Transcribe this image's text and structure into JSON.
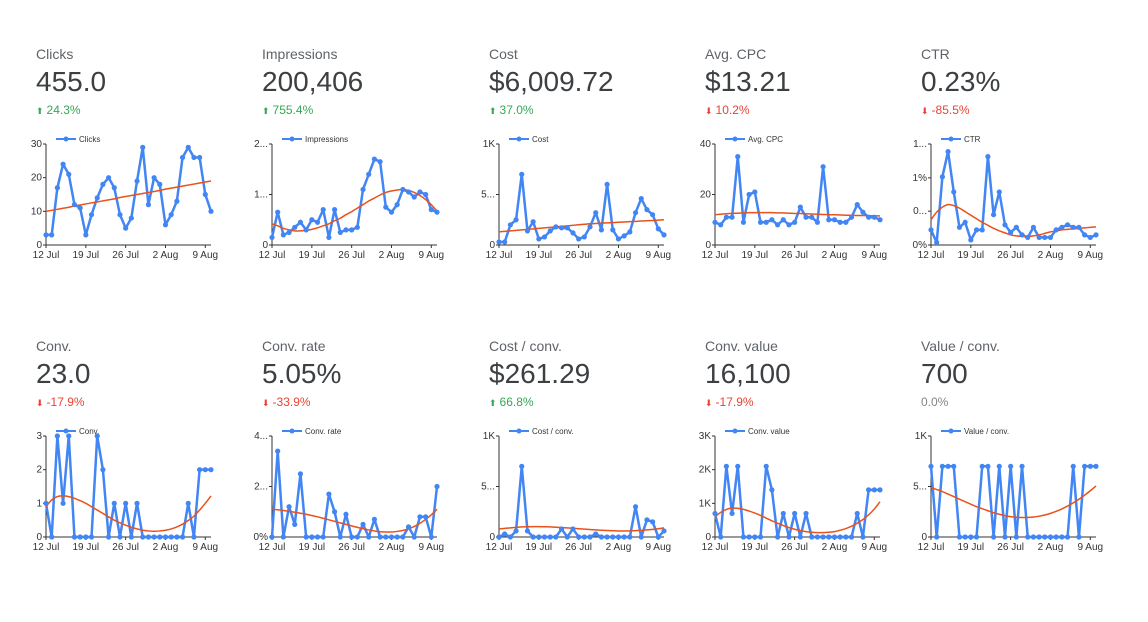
{
  "colors": {
    "series": "#4285f4",
    "trend": "#e8521c",
    "up": "#34a853",
    "down": "#ea4335",
    "flat": "#80868b",
    "axis": "#333333"
  },
  "icons": {
    "up": "arrow-up-icon",
    "down": "arrow-down-icon"
  },
  "chart_data": [
    {
      "type": "line",
      "label": "Clicks",
      "value": "455.0",
      "change": "24.3%",
      "direction": "up",
      "legend": "Clicks",
      "ylim": [
        0,
        30
      ],
      "yticks": [
        {
          "v": 0,
          "t": "0"
        },
        {
          "v": 10,
          "t": "10"
        },
        {
          "v": 20,
          "t": "20"
        },
        {
          "v": 30,
          "t": "30"
        }
      ],
      "x": [
        "12 Jul",
        "19 Jul",
        "26 Jul",
        "2 Aug",
        "9 Aug"
      ],
      "values": [
        3,
        3,
        17,
        24,
        21,
        12,
        11,
        3,
        9,
        14,
        18,
        20,
        17,
        9,
        5,
        8,
        19,
        29,
        12,
        20,
        18,
        6,
        9,
        13,
        26,
        29,
        26,
        26,
        15,
        10
      ],
      "trend": [
        10,
        10.3,
        10.6,
        10.9,
        11.2,
        11.6,
        11.9,
        12.2,
        12.5,
        12.8,
        13.1,
        13.4,
        13.7,
        14.1,
        14.4,
        14.7,
        15,
        15.3,
        15.6,
        15.9,
        16.2,
        16.6,
        16.9,
        17.2,
        17.5,
        17.8,
        18.1,
        18.4,
        18.7,
        19
      ]
    },
    {
      "type": "line",
      "label": "Impressions",
      "value": "200,406",
      "change": "755.4%",
      "direction": "up",
      "legend": "Impressions",
      "ylim": [
        0,
        2
      ],
      "yticks": [
        {
          "v": 0,
          "t": "0"
        },
        {
          "v": 1,
          "t": "1..."
        },
        {
          "v": 2,
          "t": "2..."
        }
      ],
      "x": [
        "12 Jul",
        "19 Jul",
        "26 Jul",
        "2 Aug",
        "9 Aug"
      ],
      "values": [
        0.15,
        0.65,
        0.2,
        0.25,
        0.35,
        0.45,
        0.3,
        0.5,
        0.45,
        0.7,
        0.15,
        0.7,
        0.25,
        0.3,
        0.3,
        0.35,
        1.1,
        1.4,
        1.7,
        1.65,
        0.75,
        0.65,
        0.8,
        1.1,
        1.05,
        0.95,
        1.05,
        1,
        0.7,
        0.65
      ],
      "trend": [
        0.42,
        0.38,
        0.33,
        0.3,
        0.28,
        0.28,
        0.29,
        0.31,
        0.34,
        0.38,
        0.42,
        0.48,
        0.53,
        0.6,
        0.66,
        0.73,
        0.8,
        0.87,
        0.93,
        0.99,
        1.04,
        1.07,
        1.09,
        1.1,
        1.08,
        1.04,
        0.98,
        0.9,
        0.8,
        0.67
      ]
    },
    {
      "type": "line",
      "label": "Cost",
      "value": "$6,009.72",
      "change": "37.0%",
      "direction": "up",
      "legend": "Cost",
      "ylim": [
        0,
        1000
      ],
      "yticks": [
        {
          "v": 0,
          "t": "0"
        },
        {
          "v": 500,
          "t": "5..."
        },
        {
          "v": 1000,
          "t": "1K"
        }
      ],
      "x": [
        "12 Jul",
        "19 Jul",
        "26 Jul",
        "2 Aug",
        "9 Aug"
      ],
      "values": [
        30,
        30,
        200,
        250,
        700,
        140,
        230,
        60,
        80,
        140,
        180,
        170,
        170,
        120,
        60,
        80,
        180,
        320,
        150,
        600,
        150,
        60,
        90,
        130,
        320,
        460,
        350,
        300,
        160,
        100
      ],
      "trend": [
        130,
        135,
        140,
        145,
        150,
        155,
        160,
        165,
        170,
        175,
        180,
        185,
        190,
        195,
        200,
        205,
        210,
        213,
        216,
        219,
        222,
        225,
        228,
        231,
        234,
        237,
        240,
        243,
        246,
        250
      ]
    },
    {
      "type": "line",
      "label": "Avg. CPC",
      "value": "$13.21",
      "change": "10.2%",
      "direction": "down",
      "legend": "Avg. CPC",
      "ylim": [
        0,
        40
      ],
      "yticks": [
        {
          "v": 0,
          "t": "0"
        },
        {
          "v": 20,
          "t": "20"
        },
        {
          "v": 40,
          "t": "40"
        }
      ],
      "x": [
        "12 Jul",
        "19 Jul",
        "26 Jul",
        "2 Aug",
        "9 Aug"
      ],
      "values": [
        9,
        8,
        11,
        11,
        35,
        9,
        20,
        21,
        9,
        9,
        10,
        8,
        10,
        8,
        9,
        15,
        11,
        11,
        9,
        31,
        10,
        10,
        9,
        9,
        11,
        16,
        13,
        11,
        11,
        10
      ],
      "trend": [
        12,
        12.2,
        12.4,
        12.5,
        12.6,
        12.7,
        12.8,
        12.8,
        12.8,
        12.8,
        12.8,
        12.7,
        12.7,
        12.6,
        12.5,
        12.5,
        12.4,
        12.3,
        12.2,
        12.1,
        12,
        12,
        11.9,
        11.8,
        11.8,
        11.7,
        11.7,
        11.6,
        11.6,
        11.5
      ]
    },
    {
      "type": "line",
      "label": "CTR",
      "value": "0.23%",
      "change": "-85.5%",
      "direction": "down",
      "legend": "CTR",
      "ylim": [
        0,
        2
      ],
      "yticks": [
        {
          "v": 0,
          "t": "0%"
        },
        {
          "v": 0.67,
          "t": "0..."
        },
        {
          "v": 1.33,
          "t": "1%"
        },
        {
          "v": 2,
          "t": "1..."
        }
      ],
      "x": [
        "12 Jul",
        "19 Jul",
        "26 Jul",
        "2 Aug",
        "9 Aug"
      ],
      "values": [
        0.3,
        0.05,
        1.35,
        1.85,
        1.05,
        0.35,
        0.45,
        0.1,
        0.3,
        0.3,
        1.75,
        0.6,
        1.05,
        0.4,
        0.25,
        0.35,
        0.2,
        0.15,
        0.35,
        0.15,
        0.15,
        0.15,
        0.3,
        0.35,
        0.4,
        0.35,
        0.35,
        0.2,
        0.15,
        0.2
      ],
      "trend": [
        0.5,
        0.65,
        0.75,
        0.8,
        0.78,
        0.73,
        0.66,
        0.59,
        0.52,
        0.45,
        0.39,
        0.33,
        0.28,
        0.24,
        0.2,
        0.18,
        0.17,
        0.17,
        0.18,
        0.2,
        0.23,
        0.26,
        0.28,
        0.3,
        0.31,
        0.32,
        0.33,
        0.34,
        0.35,
        0.36
      ]
    },
    {
      "type": "line",
      "label": "Conv.",
      "value": "23.0",
      "change": "-17.9%",
      "direction": "down",
      "legend": "Conv.",
      "ylim": [
        0,
        3
      ],
      "yticks": [
        {
          "v": 0,
          "t": "0"
        },
        {
          "v": 1,
          "t": "1"
        },
        {
          "v": 2,
          "t": "2"
        },
        {
          "v": 3,
          "t": "3"
        }
      ],
      "x": [
        "12 Jul",
        "19 Jul",
        "26 Jul",
        "2 Aug",
        "9 Aug"
      ],
      "values": [
        1,
        0,
        3,
        1,
        3,
        0,
        0,
        0,
        0,
        3,
        2,
        0,
        1,
        0,
        1,
        0,
        1,
        0,
        0,
        0,
        0,
        0,
        0,
        0,
        0,
        1,
        0,
        2,
        2,
        2
      ],
      "trend": [
        0.9,
        1.1,
        1.2,
        1.22,
        1.2,
        1.15,
        1.08,
        1,
        0.9,
        0.8,
        0.7,
        0.6,
        0.5,
        0.42,
        0.35,
        0.29,
        0.24,
        0.2,
        0.18,
        0.17,
        0.18,
        0.2,
        0.24,
        0.3,
        0.38,
        0.49,
        0.62,
        0.8,
        1,
        1.22
      ]
    },
    {
      "type": "line",
      "label": "Conv. rate",
      "value": "5.05%",
      "change": "-33.9%",
      "direction": "down",
      "legend": "Conv. rate",
      "ylim": [
        0,
        4
      ],
      "yticks": [
        {
          "v": 0,
          "t": "0%"
        },
        {
          "v": 2,
          "t": "2..."
        },
        {
          "v": 4,
          "t": "4..."
        }
      ],
      "x": [
        "12 Jul",
        "19 Jul",
        "26 Jul",
        "2 Aug",
        "9 Aug"
      ],
      "values": [
        0,
        3.4,
        0,
        1.2,
        0.5,
        2.5,
        0,
        0,
        0,
        0,
        1.7,
        1,
        0,
        0.9,
        0,
        0,
        0.5,
        0,
        0.7,
        0,
        0,
        0,
        0,
        0,
        0.4,
        0,
        0.8,
        0.8,
        0,
        2
      ],
      "trend": [
        1.1,
        1.08,
        1.05,
        1.02,
        0.98,
        0.94,
        0.9,
        0.85,
        0.8,
        0.74,
        0.68,
        0.62,
        0.56,
        0.5,
        0.44,
        0.38,
        0.33,
        0.28,
        0.24,
        0.21,
        0.2,
        0.2,
        0.22,
        0.26,
        0.32,
        0.42,
        0.54,
        0.7,
        0.88,
        1.1
      ]
    },
    {
      "type": "line",
      "label": "Cost / conv.",
      "value": "$261.29",
      "change": "66.8%",
      "direction": "up",
      "legend": "Cost / conv.",
      "ylim": [
        0,
        1000
      ],
      "yticks": [
        {
          "v": 0,
          "t": "0"
        },
        {
          "v": 500,
          "t": "5..."
        },
        {
          "v": 1000,
          "t": "1K"
        }
      ],
      "x": [
        "12 Jul",
        "19 Jul",
        "26 Jul",
        "2 Aug",
        "9 Aug"
      ],
      "values": [
        0,
        30,
        0,
        60,
        700,
        60,
        0,
        0,
        0,
        0,
        0,
        80,
        0,
        80,
        0,
        0,
        0,
        30,
        0,
        0,
        0,
        0,
        0,
        0,
        300,
        0,
        170,
        150,
        0,
        60
      ],
      "trend": [
        80,
        85,
        90,
        95,
        100,
        102,
        103,
        103,
        102,
        100,
        97,
        94,
        90,
        86,
        82,
        78,
        74,
        70,
        67,
        64,
        62,
        60,
        60,
        61,
        63,
        66,
        70,
        75,
        82,
        90
      ]
    },
    {
      "type": "line",
      "label": "Conv. value",
      "value": "16,100",
      "change": "-17.9%",
      "direction": "down",
      "legend": "Conv. value",
      "ylim": [
        0,
        3000
      ],
      "yticks": [
        {
          "v": 0,
          "t": "0"
        },
        {
          "v": 1000,
          "t": "1K"
        },
        {
          "v": 2000,
          "t": "2K"
        },
        {
          "v": 3000,
          "t": "3K"
        }
      ],
      "x": [
        "12 Jul",
        "19 Jul",
        "26 Jul",
        "2 Aug",
        "9 Aug"
      ],
      "values": [
        700,
        0,
        2100,
        700,
        2100,
        0,
        0,
        0,
        0,
        2100,
        1400,
        0,
        700,
        0,
        700,
        0,
        700,
        0,
        0,
        0,
        0,
        0,
        0,
        0,
        0,
        700,
        0,
        1400,
        1400,
        1400
      ],
      "trend": [
        600,
        730,
        820,
        860,
        850,
        820,
        770,
        710,
        640,
        560,
        480,
        410,
        340,
        280,
        230,
        190,
        160,
        140,
        130,
        130,
        140,
        160,
        200,
        250,
        320,
        410,
        520,
        660,
        830,
        1050
      ]
    },
    {
      "type": "line",
      "label": "Value / conv.",
      "value": "700",
      "change": "0.0%",
      "direction": "flat",
      "legend": "Value / conv.",
      "ylim": [
        0,
        1000
      ],
      "yticks": [
        {
          "v": 0,
          "t": "0"
        },
        {
          "v": 500,
          "t": "5..."
        },
        {
          "v": 1000,
          "t": "1K"
        }
      ],
      "x": [
        "12 Jul",
        "19 Jul",
        "26 Jul",
        "2 Aug",
        "9 Aug"
      ],
      "values": [
        700,
        0,
        700,
        700,
        700,
        0,
        0,
        0,
        0,
        700,
        700,
        0,
        700,
        0,
        700,
        0,
        700,
        0,
        0,
        0,
        0,
        0,
        0,
        0,
        0,
        700,
        0,
        700,
        700,
        700
      ],
      "trend": [
        490,
        470,
        450,
        425,
        400,
        375,
        350,
        325,
        300,
        280,
        260,
        240,
        225,
        212,
        202,
        196,
        193,
        194,
        198,
        206,
        218,
        234,
        254,
        278,
        306,
        338,
        374,
        414,
        458,
        505
      ]
    }
  ]
}
